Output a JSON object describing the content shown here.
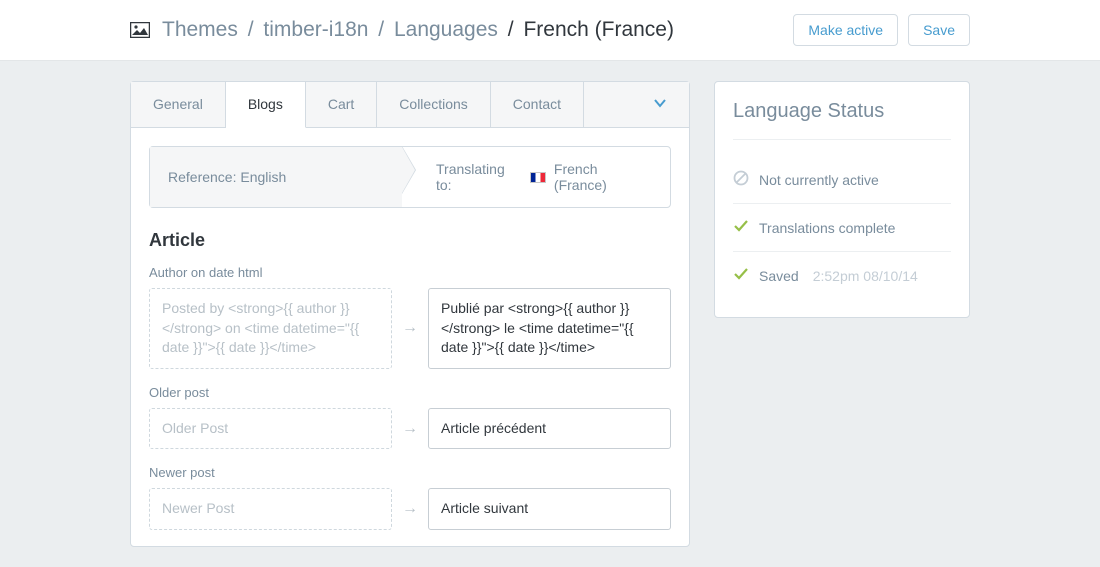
{
  "header": {
    "breadcrumb": {
      "themes": "Themes",
      "theme": "timber-i18n",
      "languages": "Languages",
      "current": "French (France)"
    },
    "actions": {
      "make_active": "Make active",
      "save": "Save"
    }
  },
  "tabs": {
    "general": "General",
    "blogs": "Blogs",
    "cart": "Cart",
    "collections": "Collections",
    "contact": "Contact"
  },
  "lang_bar": {
    "reference_label": "Reference: English",
    "translating_label": "Translating to:",
    "target_lang": "French (France)"
  },
  "section": {
    "title": "Article",
    "fields": [
      {
        "label": "Author on date html",
        "reference": "Posted by <strong>{{ author }}</strong> on <time datetime=\"{{ date }}\">{{ date }}</time>",
        "translation": "Publié par <strong>{{ author }}</strong> le <time datetime=\"{{ date }}\">{{ date }}</time>"
      },
      {
        "label": "Older post",
        "reference": "Older Post",
        "translation": "Article précédent"
      },
      {
        "label": "Newer post",
        "reference": "Newer Post",
        "translation": "Article suivant"
      }
    ]
  },
  "sidebar": {
    "title": "Language Status",
    "not_active": "Not currently active",
    "complete": "Translations complete",
    "saved": "Saved",
    "timestamp": "2:52pm 08/10/14"
  }
}
